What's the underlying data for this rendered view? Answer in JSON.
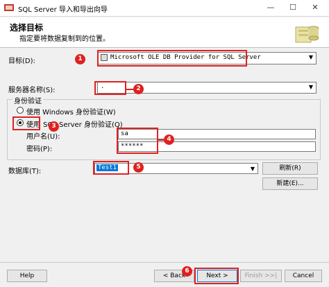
{
  "window": {
    "title": "SQL Server 导入和导出向导",
    "minimize": "—",
    "maximize": "☐",
    "close": "✕"
  },
  "header": {
    "title": "选择目标",
    "subtitle": "指定要将数据复制到的位置。"
  },
  "form": {
    "destination_label": "目标(D):",
    "destination_value": "Microsoft OLE DB Provider for SQL Server",
    "server_label": "服务器名称(S):",
    "server_value": ".",
    "auth_group_title": "身份验证",
    "windows_auth_label": "使用 Windows 身份验证(W)",
    "sql_auth_prefix": "使用",
    "sql_auth_label": "SQL Server 身份验证(Q)",
    "username_label": "用户名(U):",
    "username_value": "sa",
    "password_label": "密码(P):",
    "password_value": "******",
    "database_label": "数据库(T):",
    "database_value": "Test1",
    "refresh_button": "刷新(R)",
    "new_button": "新建(E)..."
  },
  "footer": {
    "help": "Help",
    "back": "< Back",
    "next": "Next >",
    "finish": "Finish >>|",
    "cancel": "Cancel"
  },
  "annotations": [
    "1",
    "2",
    "3",
    "4",
    "5",
    "6"
  ],
  "colors": {
    "annotation": "#e02020",
    "highlight": "#0078d7"
  }
}
